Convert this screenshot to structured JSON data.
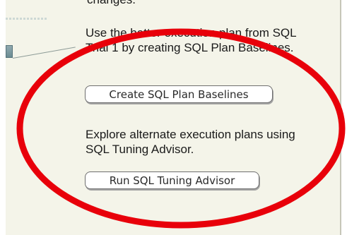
{
  "header": {
    "partial_text": "changes."
  },
  "recommendations": {
    "plan_text": "Use the better execution plan from SQL Trial 1 by creating SQL Plan Baselines.",
    "create_button_label": "Create SQL Plan Baselines",
    "tuning_text": "Explore alternate execution plans using SQL Tuning Advisor.",
    "tuning_button_label": "Run SQL Tuning Advisor"
  },
  "colors": {
    "panel_background": "#f4f4e9",
    "annotation_oval": "#e8000a",
    "button_border": "#6f6f6f"
  }
}
